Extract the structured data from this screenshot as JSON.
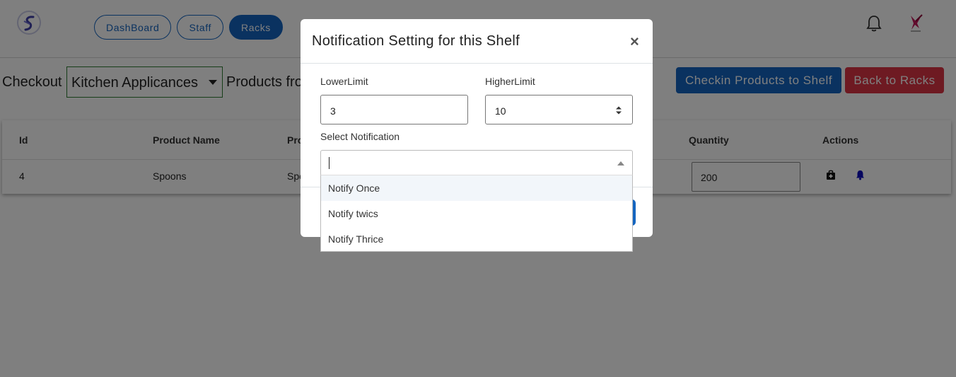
{
  "nav": {
    "items": [
      {
        "label": "DashBoard",
        "active": false
      },
      {
        "label": "Staff",
        "active": false
      },
      {
        "label": "Racks",
        "active": true
      }
    ]
  },
  "toolbar": {
    "checkout_label": "Checkout",
    "category": "Kitchen Applicances",
    "products_from": "Products fro",
    "checkin_button": "Checkin Products to Shelf",
    "back_button": "Back to Racks"
  },
  "table": {
    "headers": {
      "id": "Id",
      "name": "Product Name",
      "partial": "Pro",
      "quantity": "Quantity",
      "actions": "Actions"
    },
    "rows": [
      {
        "id": "4",
        "name": "Spoons",
        "partial": "Spo",
        "quantity": "200"
      }
    ]
  },
  "modal": {
    "title": "Notification Setting for this Shelf",
    "close": "×",
    "lower_label": "LowerLimit",
    "lower_value": "3",
    "higher_label": "HigherLimit",
    "higher_value": "10",
    "select_label": "Select Notification",
    "options": [
      "Notify Once",
      "Notify twics",
      "Notify Thrice"
    ]
  },
  "colors": {
    "primary": "#1565c0",
    "danger": "#dc3545",
    "category_border": "#2e7d32"
  },
  "icons": [
    "app-logo-icon",
    "bell-icon",
    "user-avatar-icon",
    "bag-icon",
    "notification-bell-icon",
    "spinner-arrows-icon",
    "dropdown-caret-icon"
  ]
}
